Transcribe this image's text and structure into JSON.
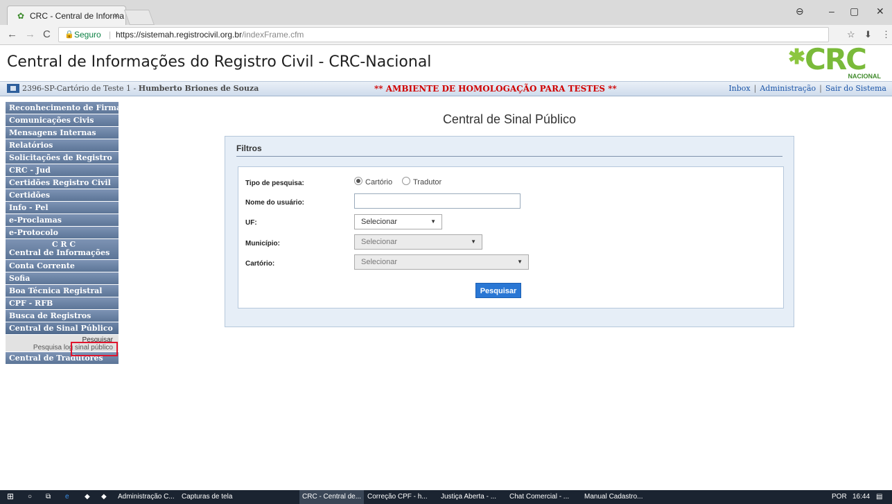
{
  "browser": {
    "tab_title": "CRC - Central de Informa",
    "tab_close": "×",
    "secure_label": "Seguro",
    "url_host": "https://sistemah.registrocivil.org.br",
    "url_path": "/indexFrame.cfm",
    "back": "←",
    "forward": "→",
    "reload": "C",
    "star": "☆",
    "download": "⬇",
    "menu": "⋮",
    "profile": "⊖",
    "minimize": "–",
    "maximize": "▢",
    "close": "✕"
  },
  "header": {
    "title": "Central de Informações do Registro Civil - CRC-Nacional",
    "logo_star": "✱",
    "logo_text": "CRC",
    "logo_sub": "NACIONAL"
  },
  "infobar": {
    "cartorio": "2396-SP-Cartório de Teste 1 - ",
    "user": "Humberto Briones de Souza",
    "ambiente": "** AMBIENTE DE HOMOLOGAÇÃO PARA TESTES **",
    "links": [
      "Inbox",
      "Administração",
      "Sair do Sistema"
    ]
  },
  "menu": {
    "items": [
      "Reconhecimento de Firma",
      "Comunicações Civis",
      "Mensagens Internas",
      "Relatórios",
      "Solicitações de Registro",
      "CRC - Jud",
      "Certidões Registro Civil",
      "Certidões",
      "Info - Pel",
      "e-Proclamas",
      "e-Protocolo"
    ],
    "crc_line1": "C R C",
    "crc_line2": "Central de Informações",
    "items2": [
      "Conta Corrente",
      "Sofia",
      "Boa Técnica Registral",
      "CPF - RFB",
      "Busca de Registros",
      "Central de Sinal Público"
    ],
    "sub1": "Pesquisar",
    "sub2": "Pesquisa log sinal público",
    "last": "Central de Tradutores"
  },
  "main": {
    "title": "Central de Sinal Público",
    "filtros": "Filtros",
    "tipo_label": "Tipo de pesquisa:",
    "radio1": "Cartório",
    "radio2": "Tradutor",
    "nome_label": "Nome do usuário:",
    "uf_label": "UF:",
    "municipio_label": "Município:",
    "cartorio_label": "Cartório:",
    "select_placeholder": "Selecionar",
    "arrow": "▼",
    "search_button": "Pesquisar"
  },
  "taskbar": {
    "apps": [
      "Administração C...",
      "Capturas de tela",
      "CRC - Central de...",
      "Correção CPF - h...",
      "Justiça Aberta - ...",
      "Chat Comercial - ...",
      "Manual Cadastro..."
    ],
    "lang": "POR",
    "time": "16:44"
  }
}
